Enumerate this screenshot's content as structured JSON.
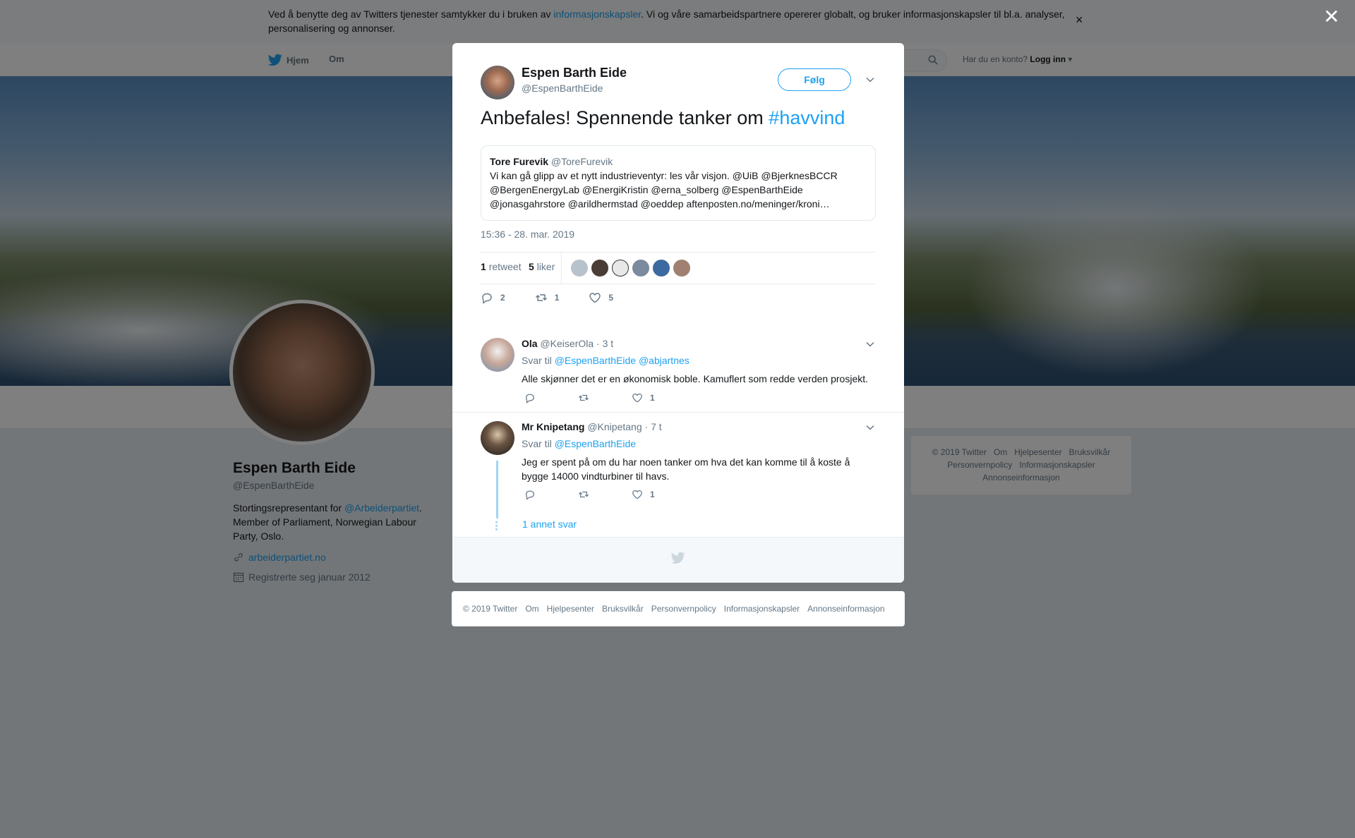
{
  "cookie": {
    "text_before": "Ved å benytte deg av Twitters tjenester samtykker du i bruken av ",
    "link": "informasjonskapsler",
    "text_after": ". Vi og våre samarbeidspartnere opererer globalt, og bruker informasjonskapsler til bl.a. analyser, personalisering og annonser.",
    "close": "×"
  },
  "nav": {
    "home": "Hjem",
    "about": "Om",
    "account_prompt": "Har du en konto?",
    "login": "Logg inn"
  },
  "profile": {
    "name": "Espen Barth Eide",
    "handle": "@EspenBarthEide",
    "bio_before": "Stortingsrepresentant for ",
    "bio_link": "@Arbeiderpartiet",
    "bio_after": ". Member of Parliament, Norwegian Labour Party, Oslo.",
    "url": "arbeiderpartiet.no",
    "joined": "Registrerte seg januar 2012"
  },
  "side_footer": [
    "© 2019 Twitter",
    "Om",
    "Hjelpesenter",
    "Bruksvilkår",
    "Personvernpolicy",
    "Informasjonskapsler",
    "Annonseinformasjon"
  ],
  "overlay_close": "✕",
  "tweet": {
    "author_name": "Espen Barth Eide",
    "author_handle": "@EspenBarthEide",
    "follow": "Følg",
    "text": "Anbefales! Spennende tanker om ",
    "hashtag": "#havvind",
    "quote": {
      "name": "Tore Furevik",
      "handle": "@ToreFurevik",
      "text": "Vi kan gå glipp av et nytt industrieventyr: les vår visjon. @UiB @BjerknesBCCR @BergenEnergyLab @EnergiKristin @erna_solberg @EspenBarthEide @jonasgahrstore @arildhermstad @oeddep  aftenposten.no/meninger/kroni…"
    },
    "time": "15:36 - 28. mar. 2019",
    "retweets": "1",
    "retweets_label": "retweet",
    "likes": "5",
    "likes_label": "liker",
    "reply_count": "2",
    "retweet_count": "1",
    "like_count": "5"
  },
  "replies": [
    {
      "name": "Ola",
      "handle": "@KeiserOla",
      "time": "· 3 t",
      "reply_to_label": "Svar til",
      "reply_to": "@EspenBarthEide @abjartnes",
      "text": "Alle skjønner det er en økonomisk boble.  Kamuflert som redde verden prosjekt.",
      "likes": "1"
    },
    {
      "name": "Mr Knipetang",
      "handle": "@Knipetang",
      "time": "· 7 t",
      "reply_to_label": "Svar til",
      "reply_to": "@EspenBarthEide",
      "text": "Jeg er spent på om du har noen tanker om hva det kan komme til å koste å bygge 14000 vindturbiner til havs.",
      "likes": "1",
      "more": "1 annet svar"
    }
  ],
  "bottom_footer": [
    "© 2019 Twitter",
    "Om",
    "Hjelpesenter",
    "Bruksvilkår",
    "Personvernpolicy",
    "Informasjonskapsler",
    "Annonseinformasjon"
  ],
  "colors": {
    "brand": "#1da1f2",
    "text": "#14171a",
    "muted": "#657786"
  }
}
